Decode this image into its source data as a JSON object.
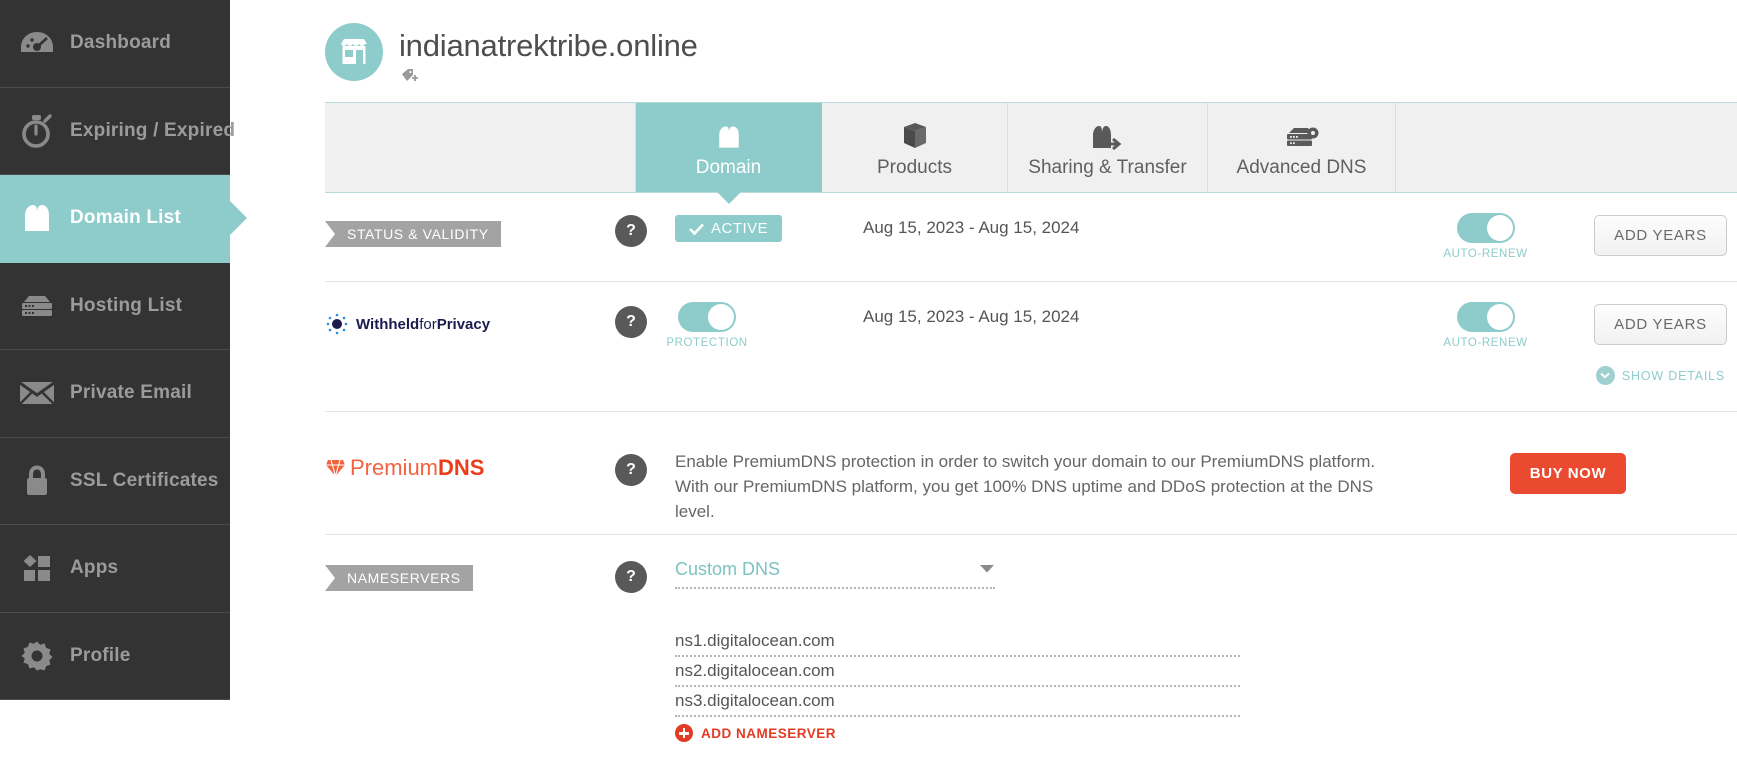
{
  "sidebar": {
    "items": [
      {
        "label": "Dashboard",
        "icon": "speedometer-icon",
        "active": false
      },
      {
        "label": "Expiring / Expired",
        "icon": "stopwatch-icon",
        "active": false
      },
      {
        "label": "Domain List",
        "icon": "house-icon",
        "active": true
      },
      {
        "label": "Hosting List",
        "icon": "server-icon",
        "active": false
      },
      {
        "label": "Private Email",
        "icon": "envelope-icon",
        "active": false
      },
      {
        "label": "SSL Certificates",
        "icon": "lock-icon",
        "active": false
      },
      {
        "label": "Apps",
        "icon": "apps-grid-icon",
        "active": false
      },
      {
        "label": "Profile",
        "icon": "gear-icon",
        "active": false
      }
    ]
  },
  "header": {
    "domain_name": "indianatrektribe.online",
    "avatar_icon": "storefront-icon",
    "tag_icon": "tag-plus-icon"
  },
  "tabs": [
    {
      "label": "Domain",
      "icon": "house-icon",
      "active": true
    },
    {
      "label": "Products",
      "icon": "box-icon",
      "active": false
    },
    {
      "label": "Sharing & Transfer",
      "icon": "house-transfer-icon",
      "active": false
    },
    {
      "label": "Advanced DNS",
      "icon": "server-gear-icon",
      "active": false
    }
  ],
  "rows": {
    "status": {
      "ribbon_label": "STATUS & VALIDITY",
      "help_label": "?",
      "status_badge": "ACTIVE",
      "status_check_icon": "check-icon",
      "date_range": "Aug 15, 2023 - Aug 15, 2024",
      "autorenew_caption": "AUTO-RENEW",
      "autorenew_on": true,
      "action_label": "ADD YEARS"
    },
    "privacy": {
      "logo_text_1": "Withheld",
      "logo_text_2": "for",
      "logo_text_3": "Privacy",
      "logo_icon": "withheldforprivacy-logo",
      "help_label": "?",
      "protection_caption": "PROTECTION",
      "protection_on": true,
      "date_range": "Aug 15, 2023 - Aug 15, 2024",
      "autorenew_caption": "AUTO-RENEW",
      "autorenew_on": true,
      "action_label": "ADD YEARS",
      "show_details_label": "SHOW DETAILS",
      "show_details_icon": "chevron-down-circle-icon"
    },
    "premiumdns": {
      "logo_text_1": "Premium",
      "logo_text_2": "DNS",
      "logo_icon": "diamond-gem-icon",
      "help_label": "?",
      "description_line1": "Enable PremiumDNS protection in order to switch your domain to our PremiumDNS platform.",
      "description_line2": "With our PremiumDNS platform, you get 100% DNS uptime and DDoS protection at the DNS level.",
      "action_label": "BUY NOW"
    },
    "nameservers": {
      "ribbon_label": "NAMESERVERS",
      "help_label": "?",
      "select_value": "Custom DNS",
      "select_caret_icon": "chevron-down-icon",
      "confirm_icon": "check-icon",
      "cancel_icon": "close-x-icon",
      "servers": [
        "ns1.digitalocean.com",
        "ns2.digitalocean.com",
        "ns3.digitalocean.com"
      ],
      "add_label": "ADD NAMESERVER",
      "add_icon": "plus-circle-icon"
    }
  },
  "colors": {
    "teal": "#8ecccc",
    "sidebar": "#333333",
    "orange": "#ea4a2f",
    "red": "#e23b26",
    "gray_ribbon": "#a3a3a3"
  }
}
